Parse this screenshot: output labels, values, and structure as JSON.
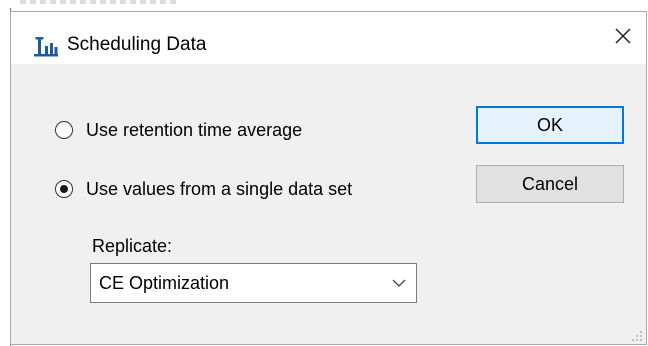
{
  "dialog": {
    "title": "Scheduling Data",
    "icon": "bar-chart-icon",
    "close_icon": "close-icon"
  },
  "options": {
    "retention_average": {
      "label": "Use retention time average",
      "selected": false
    },
    "single_data_set": {
      "label": "Use values from a single data set",
      "selected": true
    }
  },
  "replicate": {
    "label": "Replicate:",
    "selected_value": "CE Optimization",
    "icon": "chevron-down-icon"
  },
  "buttons": {
    "ok_label": "OK",
    "cancel_label": "Cancel"
  },
  "colors": {
    "accent": "#0078d7",
    "icon_blue": "#1f5aa6",
    "dialog_bg": "#f0f0f0"
  }
}
